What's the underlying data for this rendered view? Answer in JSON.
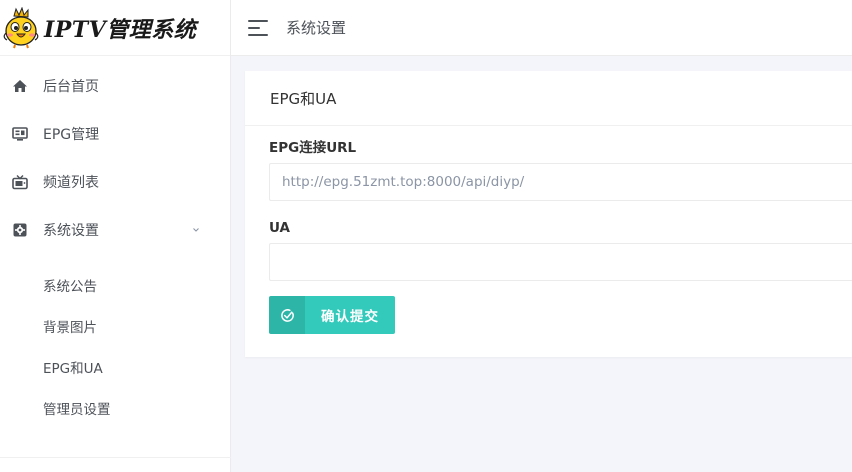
{
  "app": {
    "logo_text": "IPTV管理系统",
    "logo_icon": "chick-mascot-icon"
  },
  "header": {
    "menu_icon": "hamburger-icon",
    "title": "系统设置"
  },
  "sidebar": {
    "items": [
      {
        "label": "后台首页",
        "icon": "home-icon"
      },
      {
        "label": "EPG管理",
        "icon": "monitor-icon"
      },
      {
        "label": "频道列表",
        "icon": "tv-icon"
      },
      {
        "label": "系统设置",
        "icon": "settings-icon",
        "expanded": true
      }
    ],
    "submenu": [
      {
        "label": "系统公告"
      },
      {
        "label": "背景图片"
      },
      {
        "label": "EPG和UA"
      },
      {
        "label": "管理员设置"
      }
    ]
  },
  "card": {
    "title": "EPG和UA",
    "epg_url": {
      "label": "EPG连接URL",
      "value": "",
      "placeholder": "http://epg.51zmt.top:8000/api/diyp/"
    },
    "ua": {
      "label": "UA",
      "value": "",
      "placeholder": ""
    },
    "submit_label": "确认提交",
    "submit_icon": "check-circle-icon"
  },
  "colors": {
    "accent": "#33cabb",
    "text": "#4d5259",
    "background": "#f4f5fa"
  }
}
